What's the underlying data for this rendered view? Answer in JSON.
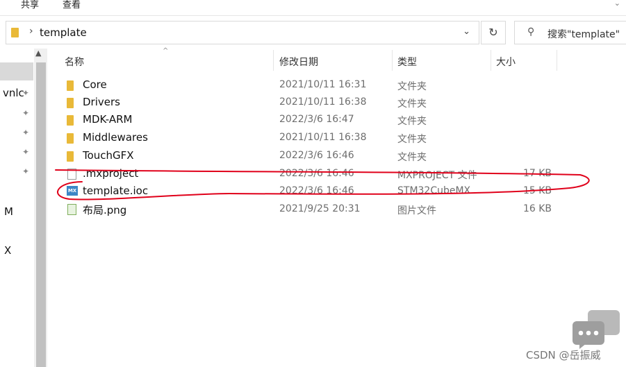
{
  "ribbon": {
    "tab1": "共享",
    "tab2": "查看"
  },
  "address": {
    "path": "template"
  },
  "search": {
    "placeholder": "搜索\"template\""
  },
  "nav": {
    "items": [
      "vnlc",
      "M",
      "X"
    ]
  },
  "columns": {
    "name": "名称",
    "date": "修改日期",
    "type": "类型",
    "size": "大小"
  },
  "files": [
    {
      "icon": "folder-icon",
      "name": "Core",
      "date": "2021/10/11 16:31",
      "type": "文件夹",
      "size": ""
    },
    {
      "icon": "folder-icon",
      "name": "Drivers",
      "date": "2021/10/11 16:38",
      "type": "文件夹",
      "size": ""
    },
    {
      "icon": "folder-icon",
      "name": "MDK-ARM",
      "date": "2022/3/6 16:47",
      "type": "文件夹",
      "size": ""
    },
    {
      "icon": "folder-icon",
      "name": "Middlewares",
      "date": "2021/10/11 16:38",
      "type": "文件夹",
      "size": ""
    },
    {
      "icon": "folder-icon",
      "name": "TouchGFX",
      "date": "2022/3/6 16:46",
      "type": "文件夹",
      "size": ""
    },
    {
      "icon": "file-icon",
      "name": ".mxproject",
      "date": "2022/3/6 16:46",
      "type": "MXPROJECT 文件",
      "size": "17 KB"
    },
    {
      "icon": "mx-file-icon",
      "name": "template.ioc",
      "date": "2022/3/6 16:46",
      "type": "STM32CubeMX",
      "size": "15 KB"
    },
    {
      "icon": "png-file-icon",
      "name": "布局.png",
      "date": "2021/9/25 20:31",
      "type": "图片文件",
      "size": "16 KB"
    }
  ],
  "watermark": {
    "text": "CSDN @岳振威"
  },
  "colors": {
    "folder": "#e9b938",
    "annotation": "#e0001a",
    "selection": "#d9d9d9"
  }
}
